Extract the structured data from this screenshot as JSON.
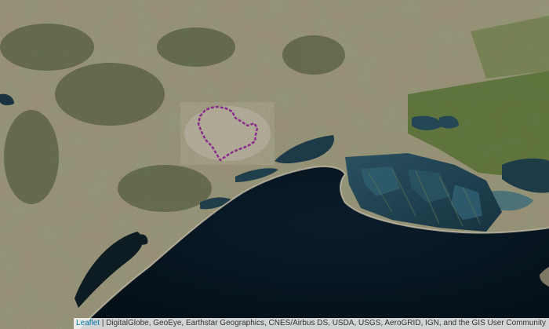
{
  "map": {
    "colors": {
      "sea": "#05121c",
      "land_base": "#8a8a6a",
      "vegetation_dark": "#3e4a2c",
      "vegetation_green": "#4f6b2c",
      "urban": "#b8b0a0",
      "lagoon": "#1f3d4a",
      "boundary": "#8a2a88"
    }
  },
  "attribution": {
    "leaflet_label": "Leaflet",
    "separator": " | ",
    "sources": "DigitalGlobe, GeoEye, Earthstar Geographics, CNES/Airbus DS, USDA, USGS, AeroGRID, IGN, and the GIS User Community"
  }
}
